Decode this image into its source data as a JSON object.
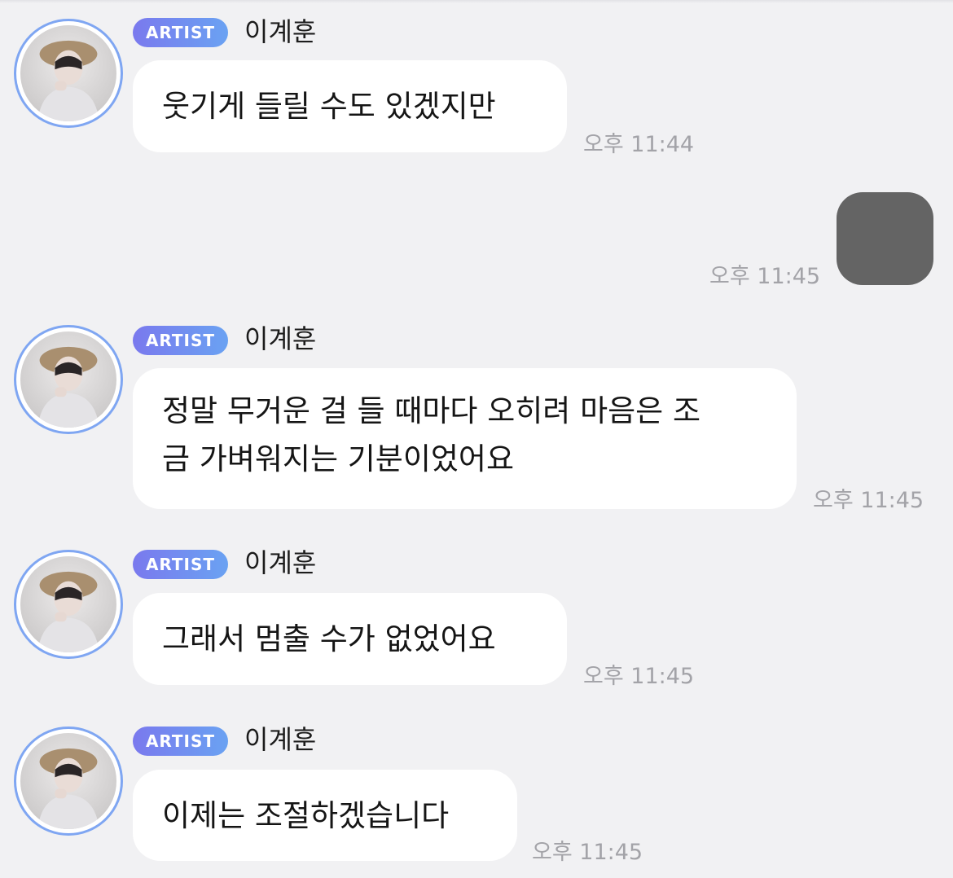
{
  "messages": [
    {
      "badge": "ARTIST",
      "name": "이계훈",
      "lines": [
        "웃기게 들릴 수도 있겠지만"
      ],
      "time": "오후 11:44"
    },
    {
      "badge": "ARTIST",
      "name": "이계훈",
      "lines": [
        "정말 무거운 걸 들 때마다 오히려 마음은 조",
        "금 가벼워지는 기분이었어요"
      ],
      "time": "오후 11:45"
    },
    {
      "badge": "ARTIST",
      "name": "이계훈",
      "lines": [
        "그래서 멈출 수가 없었어요"
      ],
      "time": "오후 11:45"
    },
    {
      "badge": "ARTIST",
      "name": "이계훈",
      "lines": [
        "이제는 조절하겠습니다"
      ],
      "time": "오후 11:45"
    }
  ],
  "sent": {
    "time": "오후 11:45"
  },
  "colors": {
    "background": "#f1f1f3",
    "bubble": "#ffffff",
    "badge_start": "#7a79ee",
    "badge_end": "#6aa2f2",
    "avatar_ring": "#7fa6f2",
    "sent_bubble": "#646464",
    "time": "#a3a3a8"
  }
}
